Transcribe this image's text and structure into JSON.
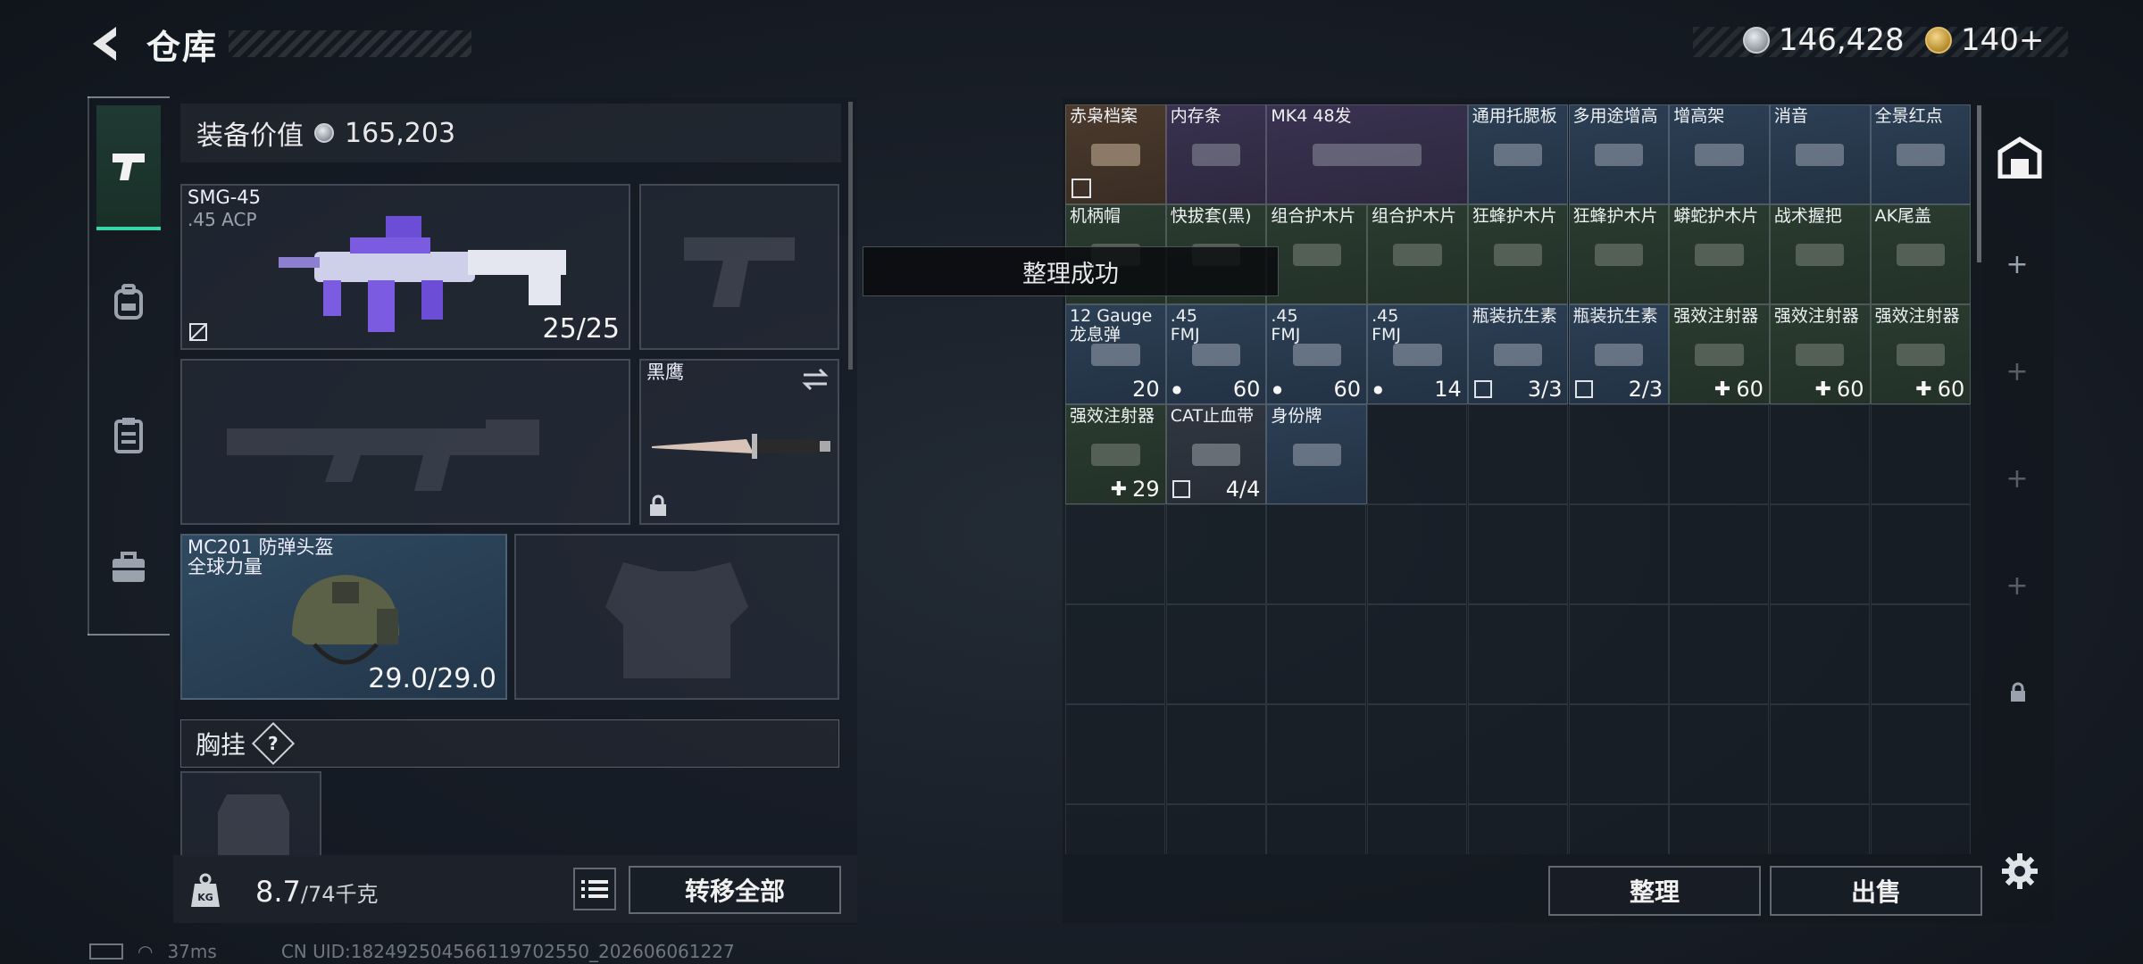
{
  "header": {
    "title": "仓库",
    "back_icon": "back-arrow-icon",
    "currency_silver": "146,428",
    "currency_gold": "140+"
  },
  "rail": {
    "items": [
      {
        "name": "weapons",
        "icon": "pistol-icon",
        "active": true
      },
      {
        "name": "backpack",
        "icon": "backpack-icon",
        "active": false
      },
      {
        "name": "clipboard",
        "icon": "clipboard-icon",
        "active": false
      },
      {
        "name": "case",
        "icon": "briefcase-icon",
        "active": false
      }
    ]
  },
  "loadout": {
    "value_label": "装备价值",
    "value": "165,203",
    "primary": {
      "name": "SMG-45",
      "ammo_type": ".45 ACP",
      "count": "25/25"
    },
    "melee": {
      "name": "黑鹰"
    },
    "helmet": {
      "name": "MC201 防弹头盔",
      "brand": "全球力量",
      "durability": "29.0/29.0"
    },
    "chest_rig": {
      "label": "胸挂",
      "help": "?"
    },
    "weight": {
      "current": "8.7",
      "max": "/74千克"
    },
    "transfer_all": "转移全部"
  },
  "toast": {
    "text": "整理成功"
  },
  "inventory": {
    "items": [
      {
        "name": "赤枭档案",
        "count": "",
        "rarity": "gold",
        "badge": "ban"
      },
      {
        "name": "内存条",
        "count": "",
        "rarity": "purple",
        "badge": ""
      },
      {
        "name": "MK4 48发",
        "count": "",
        "rarity": "purple",
        "badge": ""
      },
      {
        "name": "通用托腮板",
        "count": "",
        "rarity": "blue",
        "badge": ""
      },
      {
        "name": "多用途增高",
        "count": "",
        "rarity": "blue",
        "badge": ""
      },
      {
        "name": "增高架",
        "count": "",
        "rarity": "blue",
        "badge": ""
      },
      {
        "name": "消音",
        "count": "",
        "rarity": "blue",
        "badge": ""
      },
      {
        "name": "全景红点",
        "count": "",
        "rarity": "blue",
        "badge": ""
      },
      {
        "name": "机柄帽",
        "count": "",
        "rarity": "green",
        "badge": ""
      },
      {
        "name": "快拔套(黑)",
        "count": "",
        "rarity": "green",
        "badge": ""
      },
      {
        "name": "组合护木片",
        "count": "",
        "rarity": "green",
        "badge": ""
      },
      {
        "name": "组合护木片",
        "count": "",
        "rarity": "green",
        "badge": ""
      },
      {
        "name": "狂蜂护木片",
        "count": "",
        "rarity": "green",
        "badge": ""
      },
      {
        "name": "狂蜂护木片",
        "count": "",
        "rarity": "green",
        "badge": ""
      },
      {
        "name": "蟒蛇护木片",
        "count": "",
        "rarity": "green",
        "badge": ""
      },
      {
        "name": "战术握把",
        "count": "",
        "rarity": "green",
        "badge": ""
      },
      {
        "name": "AK尾盖",
        "count": "",
        "rarity": "green",
        "badge": ""
      },
      {
        "name": "12 Gauge",
        "sub": "龙息弹",
        "count": "20",
        "rarity": "blue",
        "badge": ""
      },
      {
        "name": ".45",
        "sub": "FMJ",
        "count": "60",
        "rarity": "blue",
        "badge": "dot"
      },
      {
        "name": ".45",
        "sub": "FMJ",
        "count": "60",
        "rarity": "blue",
        "badge": "dot"
      },
      {
        "name": ".45",
        "sub": "FMJ",
        "count": "14",
        "rarity": "blue",
        "badge": "dot"
      },
      {
        "name": "瓶装抗生素",
        "count": "3/3",
        "rarity": "blue",
        "badge": "ban"
      },
      {
        "name": "瓶装抗生素",
        "count": "2/3",
        "rarity": "blue",
        "badge": "ban"
      },
      {
        "name": "强效注射器",
        "count": "60",
        "rarity": "green",
        "badge": "plus"
      },
      {
        "name": "强效注射器",
        "count": "60",
        "rarity": "green",
        "badge": "plus"
      },
      {
        "name": "强效注射器",
        "count": "60",
        "rarity": "green",
        "badge": "plus"
      },
      {
        "name": "强效注射器",
        "count": "29",
        "rarity": "green",
        "badge": "plus"
      },
      {
        "name": "CAT止血带",
        "count": "4/4",
        "rarity": "grey",
        "badge": "ban"
      },
      {
        "name": "身份牌",
        "count": "",
        "rarity": "blue",
        "badge": ""
      }
    ],
    "sort_button": "整理",
    "sell_button": "出售"
  },
  "footer": {
    "ping": "37ms",
    "uid": "CN UID:18249250456611970255​0_202606061227"
  }
}
